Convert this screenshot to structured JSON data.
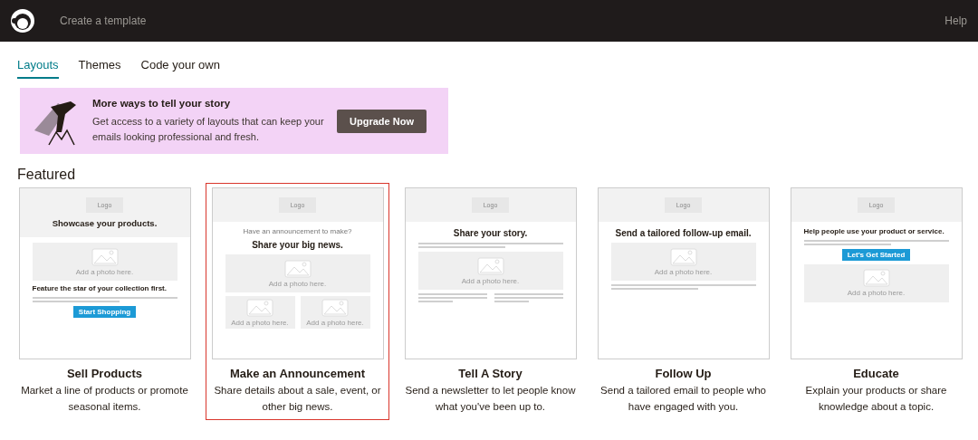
{
  "topbar": {
    "title": "Create a template",
    "help": "Help"
  },
  "tabs": [
    {
      "label": "Layouts",
      "selected": true
    },
    {
      "label": "Themes",
      "selected": false
    },
    {
      "label": "Code your own",
      "selected": false
    }
  ],
  "banner": {
    "title": "More ways to tell your story",
    "text": "Get access to a variety of layouts that can keep your emails looking professional and fresh.",
    "button": "Upgrade Now"
  },
  "section_title": "Featured",
  "templates": [
    {
      "name": "Sell Products",
      "description": "Market a line of products or promote seasonal items.",
      "selected": false,
      "logo": "Logo",
      "header_headline": "Showcase your products.",
      "blocks": [
        {
          "kind": "photo",
          "caption": "Add a photo here."
        },
        {
          "kind": "subhead",
          "text": "Feature the star of your collection first."
        },
        {
          "kind": "lines"
        },
        {
          "kind": "button",
          "label": "Start Shopping"
        }
      ]
    },
    {
      "name": "Make an Announcement",
      "description": "Share details about a sale, event, or other big news.",
      "selected": true,
      "logo": "Logo",
      "blocks": [
        {
          "kind": "pretitle",
          "text": "Have an announcement to make?"
        },
        {
          "kind": "headline",
          "text": "Share your big news."
        },
        {
          "kind": "photo",
          "caption": "Add a photo here."
        },
        {
          "kind": "photo-row",
          "captions": [
            "Add a photo here.",
            "Add a photo here."
          ]
        }
      ]
    },
    {
      "name": "Tell A Story",
      "description": "Send a newsletter to let people know what you've been up to.",
      "selected": false,
      "logo": "Logo",
      "blocks": [
        {
          "kind": "headline",
          "text": "Share your story."
        },
        {
          "kind": "lines"
        },
        {
          "kind": "photo",
          "caption": "Add a photo here."
        },
        {
          "kind": "columns"
        }
      ]
    },
    {
      "name": "Follow Up",
      "description": "Send a tailored email to people who have engaged with you.",
      "selected": false,
      "logo": "Logo",
      "blocks": [
        {
          "kind": "headline",
          "text": "Send a tailored follow-up email."
        },
        {
          "kind": "photo",
          "caption": "Add a photo here."
        },
        {
          "kind": "lines"
        }
      ]
    },
    {
      "name": "Educate",
      "description": "Explain your products or share knowledge about a topic.",
      "selected": false,
      "logo": "Logo",
      "blocks": [
        {
          "kind": "subhead",
          "text": "Help people use your product or service."
        },
        {
          "kind": "lines"
        },
        {
          "kind": "button",
          "label": "Let's Get Started"
        },
        {
          "kind": "photo",
          "caption": "Add a photo here."
        }
      ]
    }
  ]
}
